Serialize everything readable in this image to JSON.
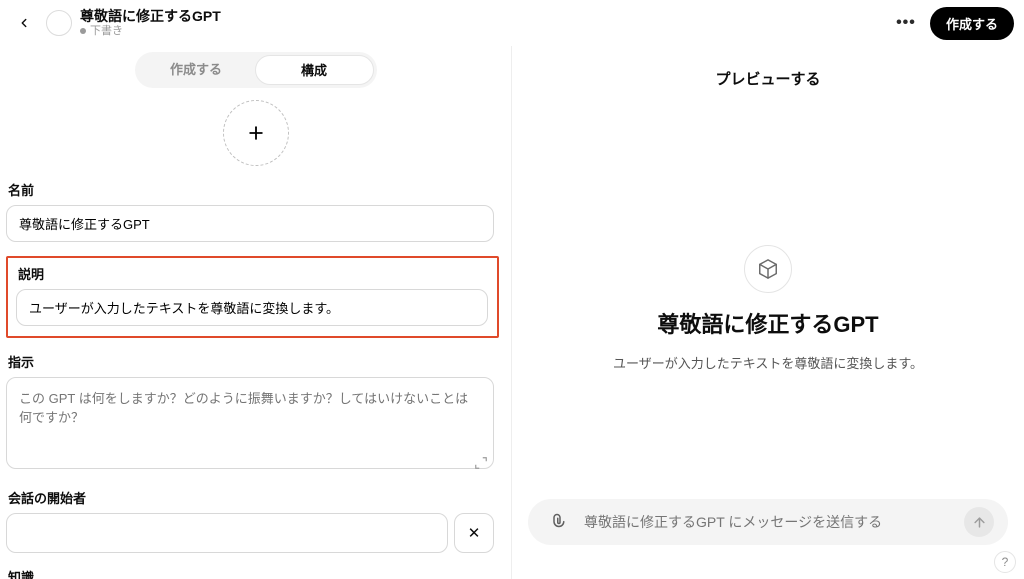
{
  "header": {
    "title": "尊敬語に修正するGPT",
    "status": "下書き",
    "create_button": "作成する"
  },
  "tabs": {
    "create": "作成する",
    "configure": "構成"
  },
  "form": {
    "name_label": "名前",
    "name_value": "尊敬語に修正するGPT",
    "desc_label": "説明",
    "desc_value": "ユーザーが入力したテキストを尊敬語に変換します。",
    "instr_label": "指示",
    "instr_placeholder": "この GPT は何をしますか？どのように振舞いますか？してはいけないことは何ですか？",
    "starters_label": "会話の開始者",
    "starter_value": "",
    "knowledge_label": "知識"
  },
  "preview": {
    "heading": "プレビューする",
    "name": "尊敬語に修正するGPT",
    "desc": "ユーザーが入力したテキストを尊敬語に変換します。",
    "input_placeholder": "尊敬語に修正するGPT にメッセージを送信する"
  },
  "glyphs": {
    "close_x": "✕",
    "help_q": "?"
  }
}
